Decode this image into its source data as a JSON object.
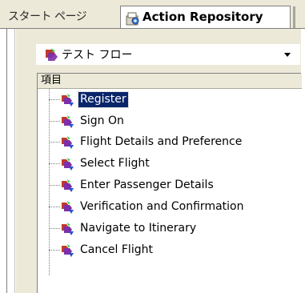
{
  "tabs": {
    "inactive_label": "スタート ページ",
    "active_label": "Action Repository",
    "active_icon": "repository-icon"
  },
  "combo": {
    "label": "テスト フロー",
    "icon": "test-flow-icon"
  },
  "list": {
    "column_header": "項目",
    "items": [
      {
        "label": "Register",
        "selected": true
      },
      {
        "label": "Sign On"
      },
      {
        "label": "Flight Details and Preference"
      },
      {
        "label": "Select Flight"
      },
      {
        "label": "Enter Passenger Details"
      },
      {
        "label": "Verification and Confirmation"
      },
      {
        "label": "Navigate to Itinerary"
      },
      {
        "label": "Cancel Flight"
      }
    ]
  },
  "colors": {
    "selection": "#0a246a",
    "chrome": "#ece9d8",
    "action_icon_purple": "#7b2fa8",
    "action_icon_blue": "#2a4fd0"
  }
}
